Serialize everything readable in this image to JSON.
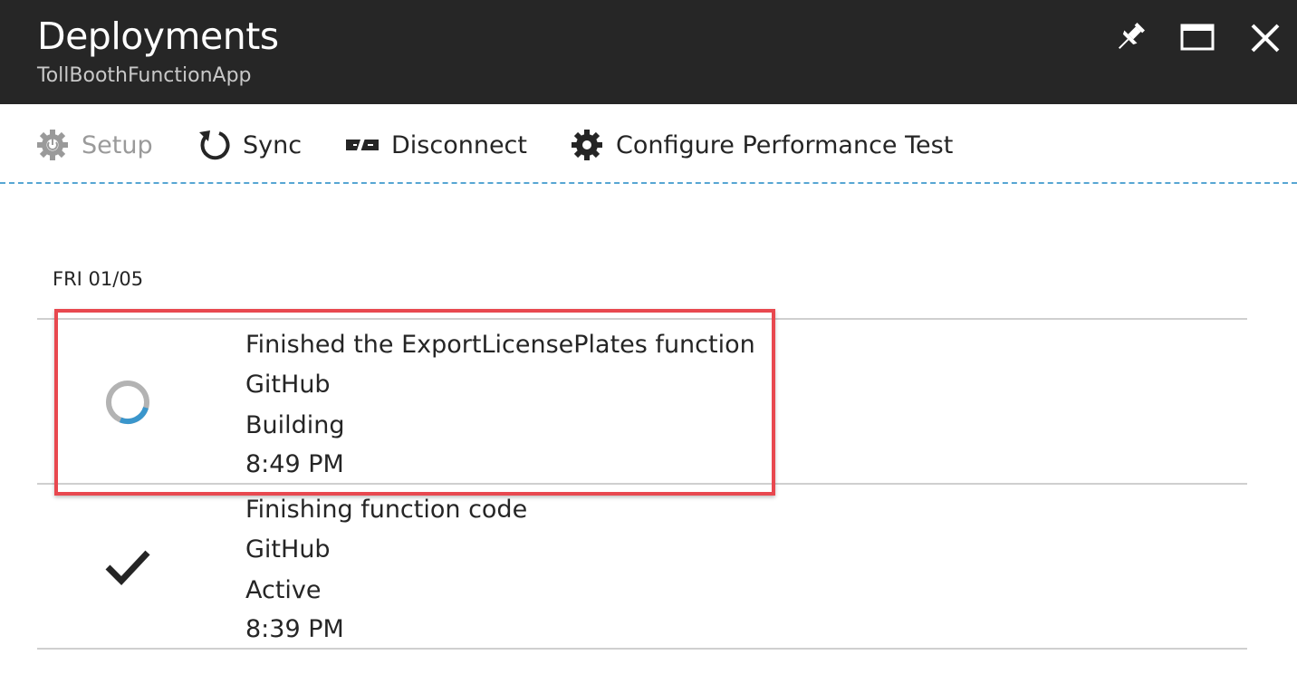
{
  "blade": {
    "title": "Deployments",
    "subtitle": "TollBoothFunctionApp",
    "controls": {
      "pin_icon": "pin-icon",
      "maximize_icon": "maximize-icon",
      "close_icon": "close-icon"
    }
  },
  "toolbar": {
    "commands": [
      {
        "label": "Setup",
        "icon": "setup-gear-icon",
        "enabled": false
      },
      {
        "label": "Sync",
        "icon": "sync-icon",
        "enabled": true
      },
      {
        "label": "Disconnect",
        "icon": "disconnect-icon",
        "enabled": true
      },
      {
        "label": "Configure Performance Test",
        "icon": "gear-icon",
        "enabled": true
      }
    ]
  },
  "deployments": {
    "date_header": "FRI 01/05",
    "items": [
      {
        "message": "Finished the ExportLicensePlates function",
        "source": "GitHub",
        "status": "Building",
        "time": "8:49 PM",
        "icon": "spinner-icon",
        "highlighted": true
      },
      {
        "message": "Finishing function code",
        "source": "GitHub",
        "status": "Active",
        "time": "8:39 PM",
        "icon": "checkmark-icon",
        "highlighted": false
      }
    ]
  },
  "colors": {
    "titlebar_bg": "#262626",
    "accent_blue": "#3a96cc",
    "highlight_red": "#e8484f",
    "disabled_text": "#9a9a9a"
  }
}
